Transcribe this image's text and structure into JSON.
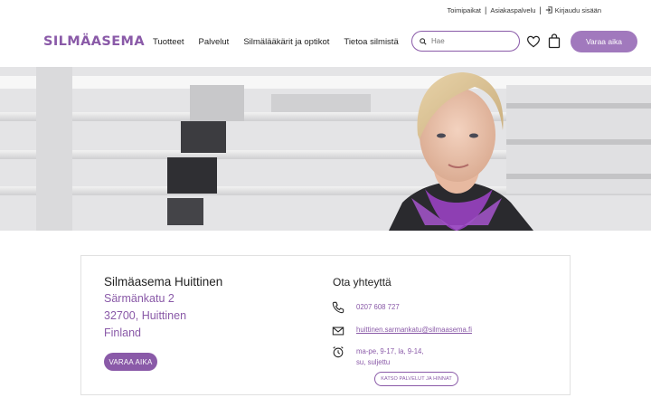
{
  "utility": {
    "locations": "Toimipaikat",
    "customer_service": "Asiakaspalvelu",
    "login": "Kirjaudu sisään"
  },
  "header": {
    "logo_text": "SILMÄASEMA",
    "nav": [
      "Tuotteet",
      "Palvelut",
      "Silmälääkärit ja optikot",
      "Tietoa silmistä"
    ],
    "search_placeholder": "Hae",
    "cta": "Varaa aika"
  },
  "store": {
    "name": "Silmäasema Huittinen",
    "street": "Särmänkatu 2",
    "city": "32700, Huittinen",
    "country": "Finland",
    "book_button": "VARAA AIKA"
  },
  "contact": {
    "title": "Ota yhteyttä",
    "phone": "0207 608 727",
    "email": "huittinen.sarmankatu@silmaasema.fi",
    "hours_line1": "ma-pe, 9-17, la, 9-14,",
    "hours_line2": "su, suljettu",
    "services_button": "KATSO PALVELUT JA HINNAT"
  },
  "colors": {
    "brand": "#8a5aa8",
    "cta_light": "#a179bd"
  },
  "icons": [
    "search-icon",
    "heart-icon",
    "shopping-bag-icon",
    "login-icon",
    "phone-icon",
    "mail-icon",
    "alarm-clock-icon"
  ]
}
